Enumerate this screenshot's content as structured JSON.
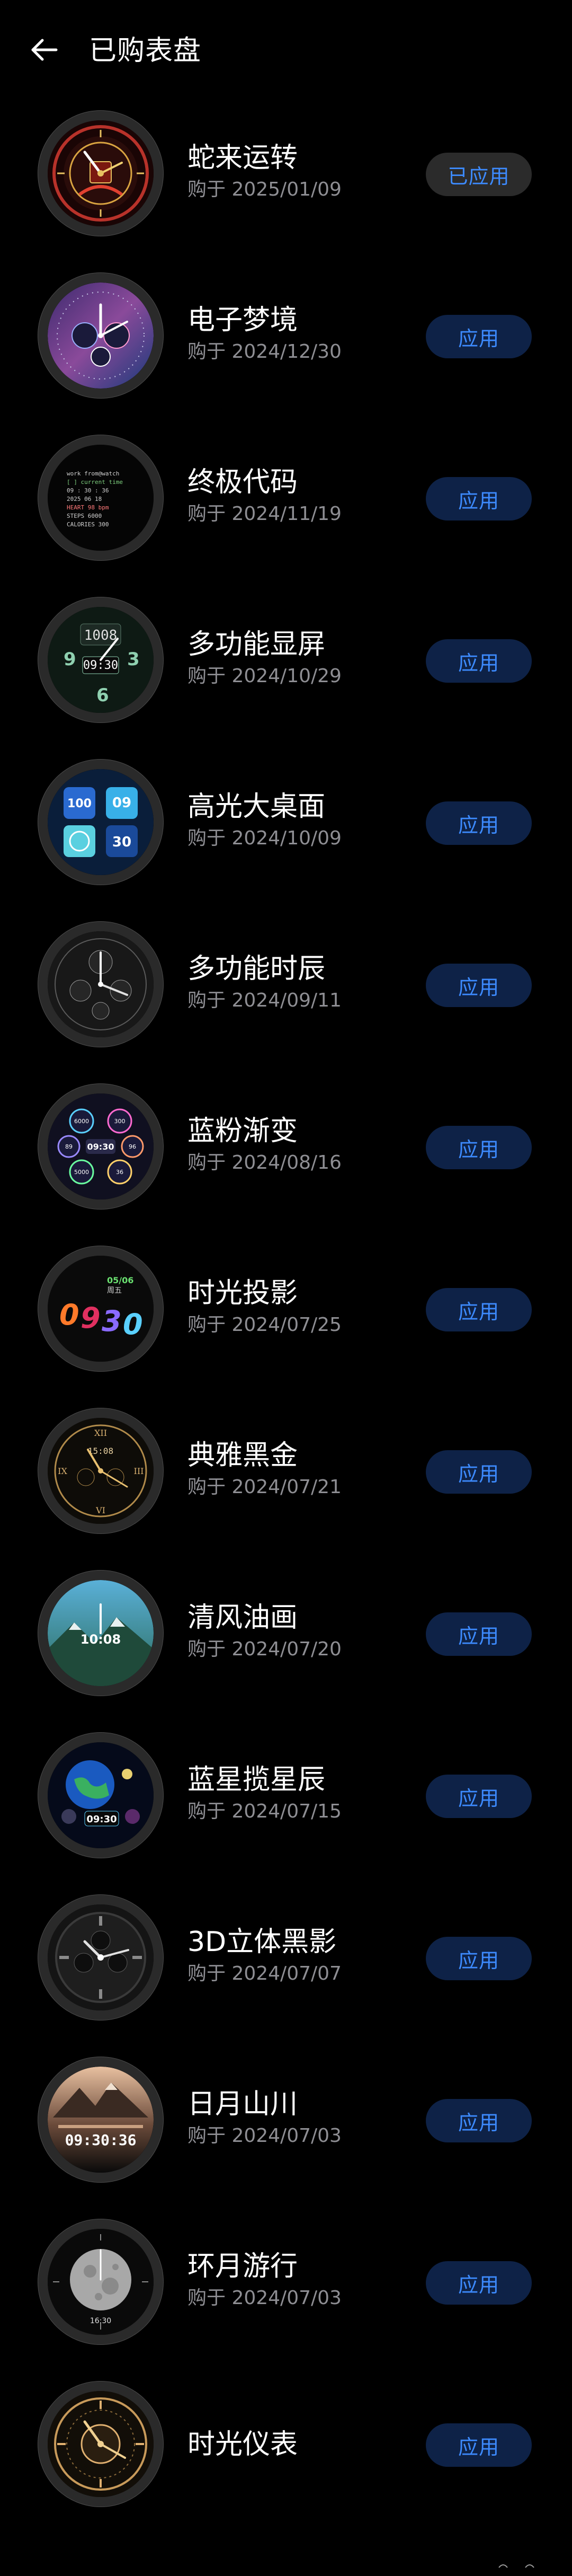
{
  "header": {
    "title": "已购表盘",
    "back_icon": "arrow-left-icon"
  },
  "colors": {
    "background": "#000000",
    "accent": "#3d8bff",
    "button_bg": "#0e2247",
    "applied_button_bg": "#2b2b2b",
    "secondary_text": "#8e8e93"
  },
  "faces": [
    {
      "name": "蛇来运转",
      "date": "购于 2025/01/09",
      "action": "已应用",
      "applied": true
    },
    {
      "name": "电子梦境",
      "date": "购于 2024/12/30",
      "action": "应用",
      "applied": false
    },
    {
      "name": "终极代码",
      "date": "购于 2024/11/19",
      "action": "应用",
      "applied": false
    },
    {
      "name": "多功能显屏",
      "date": "购于 2024/10/29",
      "action": "应用",
      "applied": false
    },
    {
      "name": "高光大桌面",
      "date": "购于 2024/10/09",
      "action": "应用",
      "applied": false
    },
    {
      "name": "多功能时辰",
      "date": "购于 2024/09/11",
      "action": "应用",
      "applied": false
    },
    {
      "name": "蓝粉渐变",
      "date": "购于 2024/08/16",
      "action": "应用",
      "applied": false
    },
    {
      "name": "时光投影",
      "date": "购于 2024/07/25",
      "action": "应用",
      "applied": false
    },
    {
      "name": "典雅黑金",
      "date": "购于 2024/07/21",
      "action": "应用",
      "applied": false
    },
    {
      "name": "清风油画",
      "date": "购于 2024/07/20",
      "action": "应用",
      "applied": false
    },
    {
      "name": "蓝星揽星辰",
      "date": "购于 2024/07/15",
      "action": "应用",
      "applied": false
    },
    {
      "name": "3D立体黑影",
      "date": "购于 2024/07/07",
      "action": "应用",
      "applied": false
    },
    {
      "name": "日月山川",
      "date": "购于 2024/07/03",
      "action": "应用",
      "applied": false
    },
    {
      "name": "环月游行",
      "date": "购于 2024/07/03",
      "action": "应用",
      "applied": false
    },
    {
      "name": "时光仪表",
      "date": "",
      "action": "应用",
      "applied": false
    }
  ],
  "thumb_text": {
    "f1_time": "09:30",
    "f1_day": "周五",
    "f2_time": "08",
    "f3_lines": [
      "work from@watch",
      "[ ] current time",
      "09 : 30 : 36",
      "2025 06 18",
      "HEART 98 bpm",
      "STEPS 6000",
      "CALORIES 300",
      "work from@watch"
    ],
    "f4_time": "1008",
    "f4_sub": "09:30",
    "f5_tiles": [
      "100",
      "09",
      "30"
    ],
    "f7_values": [
      "6000",
      "300",
      "80",
      "96",
      "89",
      "36",
      "09",
      "5000"
    ],
    "f7_time": "09:30",
    "f8_date": "05/06",
    "f8_day": "周五",
    "f8_digits": [
      "0",
      "9",
      "3",
      "0"
    ],
    "f9_time": "15:08",
    "f10_time": "10:08",
    "f11_time": "09:30",
    "f13_time": "09:30:36",
    "f14_time": "16:30"
  },
  "gesture_bar": {
    "icons": [
      "gesture-icon-1",
      "gesture-icon-2"
    ]
  }
}
